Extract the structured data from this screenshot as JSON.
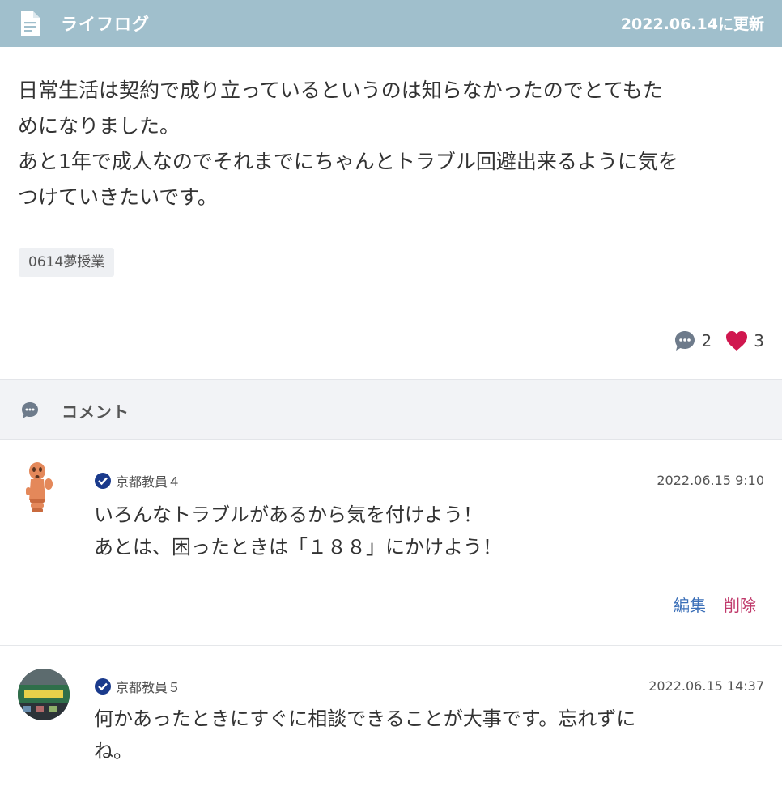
{
  "header": {
    "title": "ライフログ",
    "updated": "2022.06.14に更新",
    "icon": "document-icon"
  },
  "post": {
    "body": "日常生活は契約で成り立っているというのは知らなかったのでとてもた\nめになりました。\nあと1年で成人なのでそれまでにちゃんとトラブル回避出来るように気を\nつけていきたいです。",
    "tag": "0614夢授業"
  },
  "stats": {
    "comment_count": "2",
    "like_count": "3"
  },
  "comments_section": {
    "label": "コメント"
  },
  "comments": [
    {
      "author": "京都教員４",
      "time": "2022.06.15 9:10",
      "text": "いろんなトラブルがあるから気を付けよう！\nあとは、困ったときは「１８８」にかけよう！",
      "edit_label": "編集",
      "delete_label": "削除"
    },
    {
      "author": "京都教員５",
      "time": "2022.06.15 14:37",
      "text": "何かあったときにすぐに相談できることが大事です。忘れずに\nね。"
    }
  ],
  "colors": {
    "header_bg": "#a0bfcc",
    "heart": "#d0174f",
    "edit": "#3b6fb8",
    "delete": "#c0396b",
    "verified": "#1a3a8c"
  }
}
